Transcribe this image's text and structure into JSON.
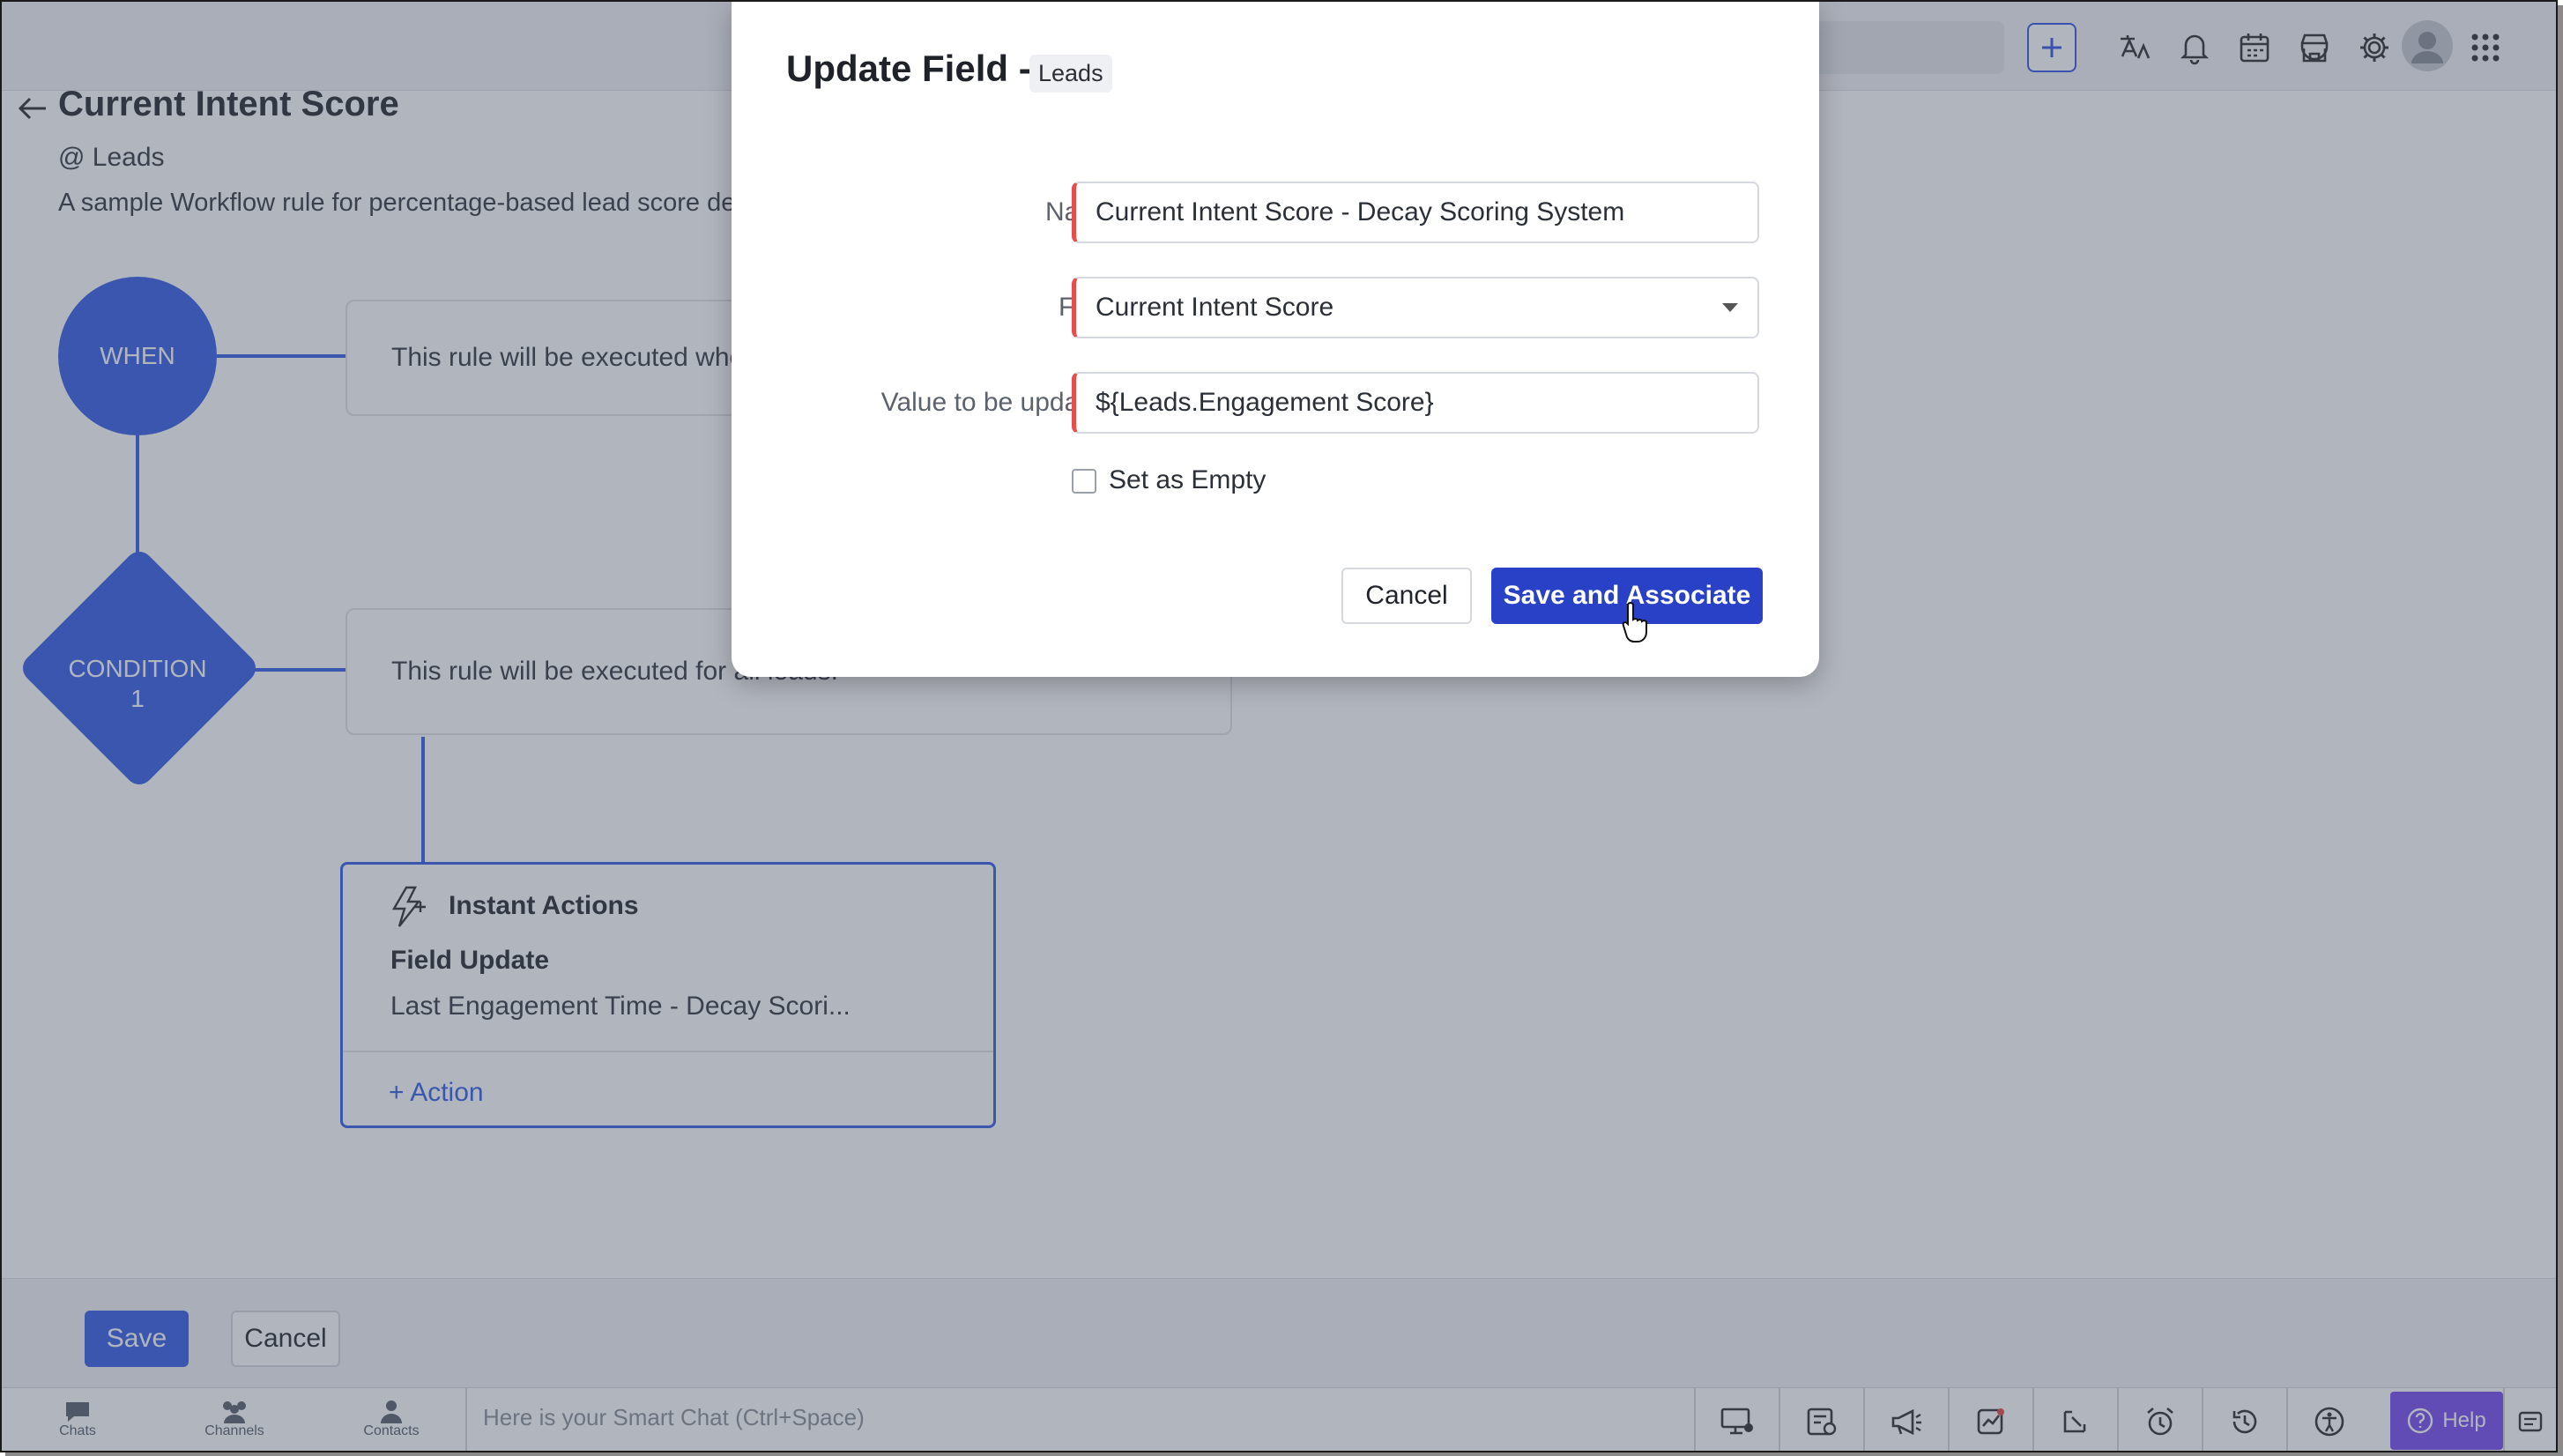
{
  "header": {
    "page_title": "Current Intent Score",
    "module": "@ Leads",
    "description": "A sample Workflow rule for percentage-based lead score de"
  },
  "workflow": {
    "when_label": "WHEN",
    "when_text": "This rule will be executed whe",
    "condition_label_line1": "CONDITION",
    "condition_label_line2": "1",
    "condition_text": "This rule will be executed for all leads.",
    "actions": {
      "title": "Instant Actions",
      "subtitle": "Field Update",
      "description": "Last Engagement Time - Decay Scori...",
      "add_label": "+ Action"
    }
  },
  "bottom": {
    "save_label": "Save",
    "cancel_label": "Cancel"
  },
  "status_bar": {
    "chats": "Chats",
    "channels": "Channels",
    "contacts": "Contacts",
    "smart_chat_placeholder": "Here is your Smart Chat (Ctrl+Space)",
    "help": "Help"
  },
  "modal": {
    "title": "Update Field -",
    "badge": "Leads",
    "name_label": "Name",
    "name_value": "Current Intent Score - Decay Scoring System",
    "field_label": "Field",
    "field_value": "Current Intent Score",
    "value_label": "Value to be updated",
    "value_value": "${Leads.Engagement Score}",
    "set_empty_label": "Set as Empty",
    "set_empty_checked": false,
    "cancel_label": "Cancel",
    "save_label": "Save and Associate"
  },
  "colors": {
    "accent": "#3b62e6",
    "primary_button": "#2841c7",
    "required_marker": "#e84c4c",
    "help": "#7b4ff0"
  },
  "icons": [
    "back-arrow-icon",
    "plus-icon",
    "translate-icon",
    "bell-icon",
    "calendar-icon",
    "marketplace-icon",
    "gear-icon",
    "avatar-icon",
    "app-grid-icon",
    "lightning-icon",
    "chat-icon",
    "channels-icon",
    "contacts-icon",
    "pointer-hand-icon"
  ]
}
